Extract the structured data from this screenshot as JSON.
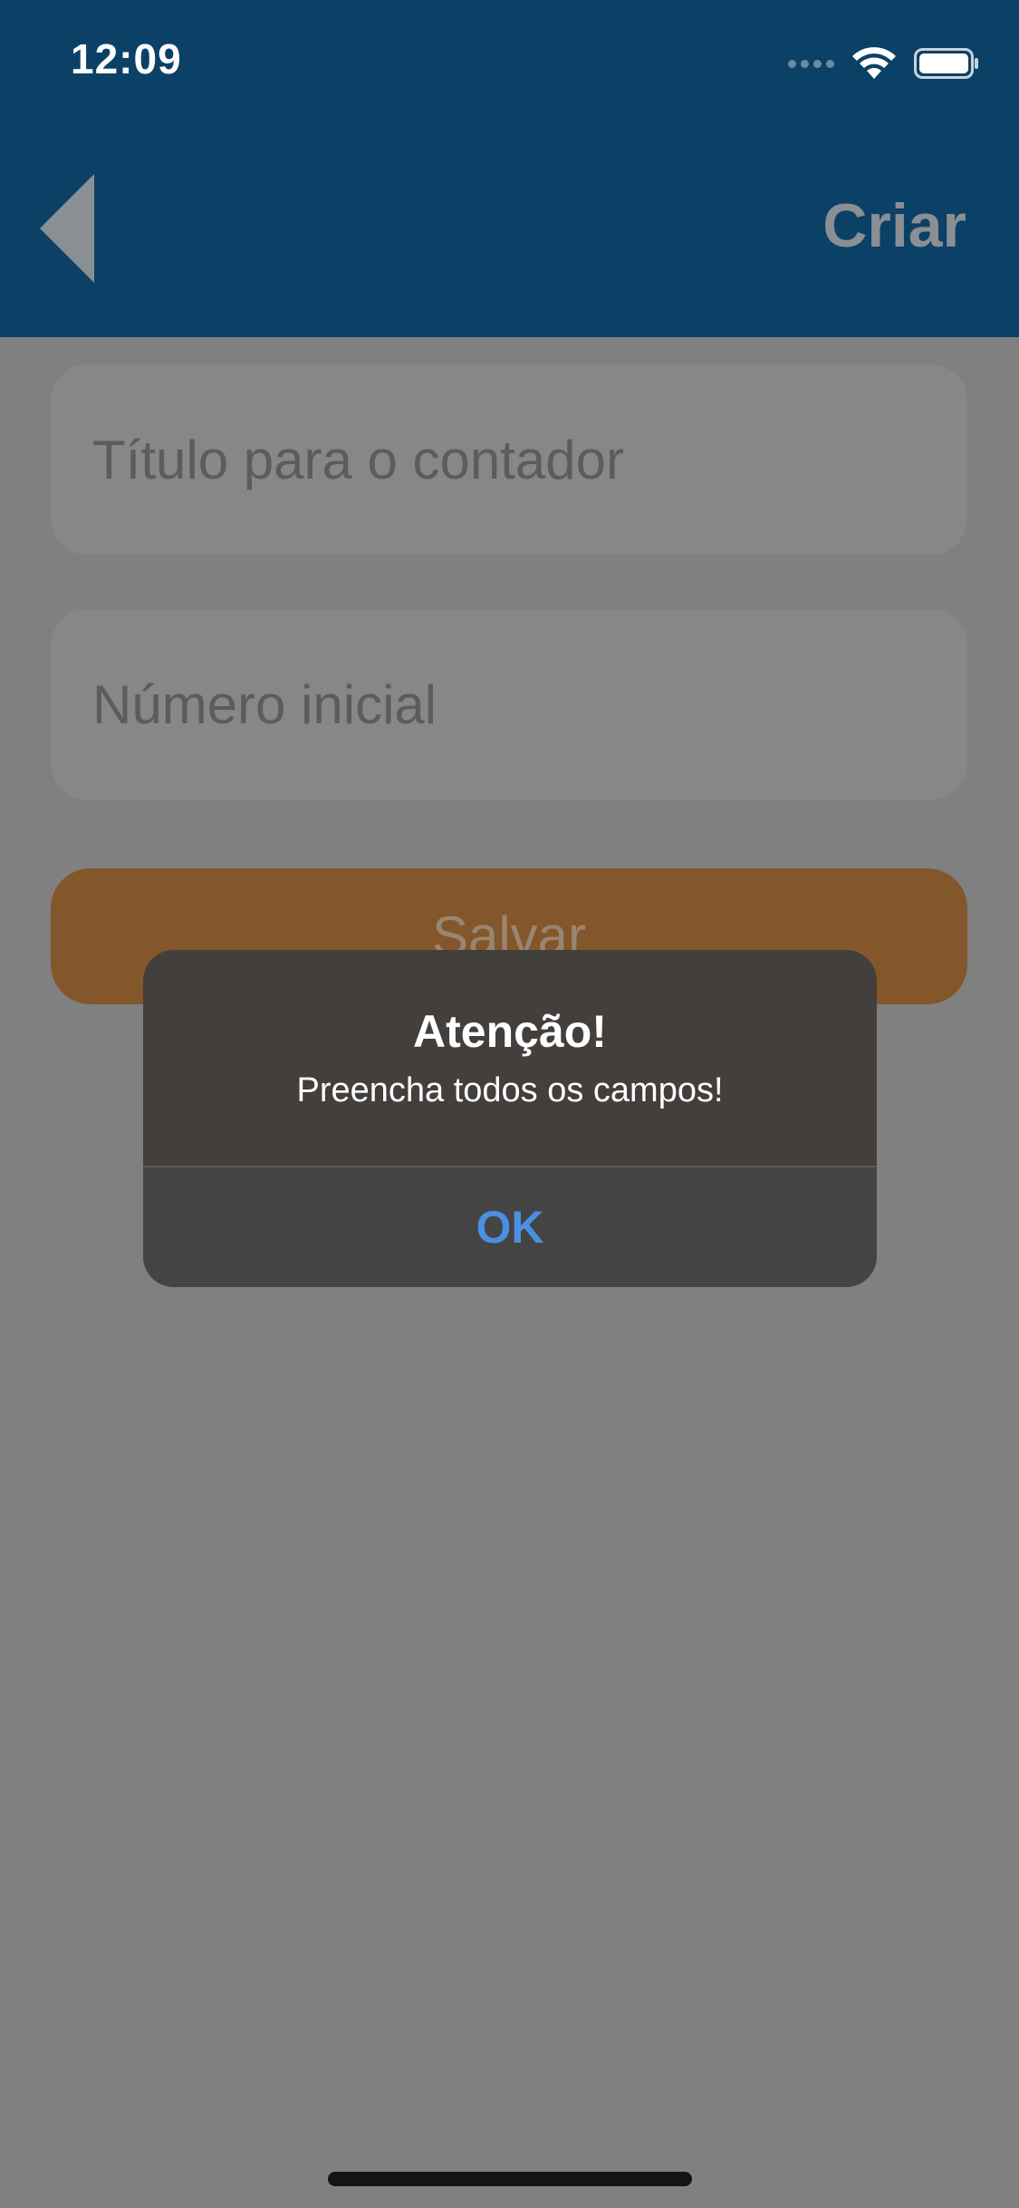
{
  "status_bar": {
    "time": "12:09",
    "icons": [
      "signal-icon",
      "wifi-icon",
      "battery-icon"
    ]
  },
  "nav": {
    "back_icon": "back-arrow-icon",
    "action_label": "Criar"
  },
  "form": {
    "title_placeholder": "Título para o contador",
    "number_placeholder": "Número inicial",
    "save_label": "Salvar"
  },
  "alert": {
    "title": "Atenção!",
    "message": "Preencha todos os campos!",
    "ok_label": "OK"
  },
  "colors": {
    "header": "#0b4166",
    "save_button": "#e08c30",
    "alert_link": "#4a90e2"
  }
}
